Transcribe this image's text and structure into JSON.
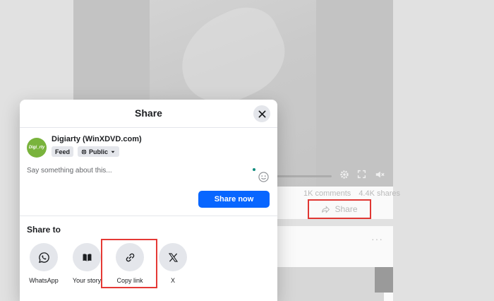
{
  "background_post": {
    "stats": {
      "comments": "1K comments",
      "shares": "4.4K shares"
    },
    "share_label": "Share",
    "more_label": "···"
  },
  "dialog": {
    "title": "Share",
    "page_name": "Digiarty (WinXDVD.com)",
    "avatar_text": "Digi_rty",
    "feed_label": "Feed",
    "privacy_label": "Public",
    "message_placeholder": "Say something about this...",
    "share_now_label": "Share now",
    "share_to_label": "Share to",
    "targets": [
      {
        "label": "WhatsApp",
        "icon": "whatsapp-icon"
      },
      {
        "label": "Your story",
        "icon": "book-icon"
      },
      {
        "label": "Copy link",
        "icon": "link-icon"
      },
      {
        "label": "X",
        "icon": "x-logo-icon"
      }
    ]
  },
  "colors": {
    "primary_button": "#0866ff",
    "highlight": "#e53935",
    "avatar_green": "#79b33c"
  }
}
